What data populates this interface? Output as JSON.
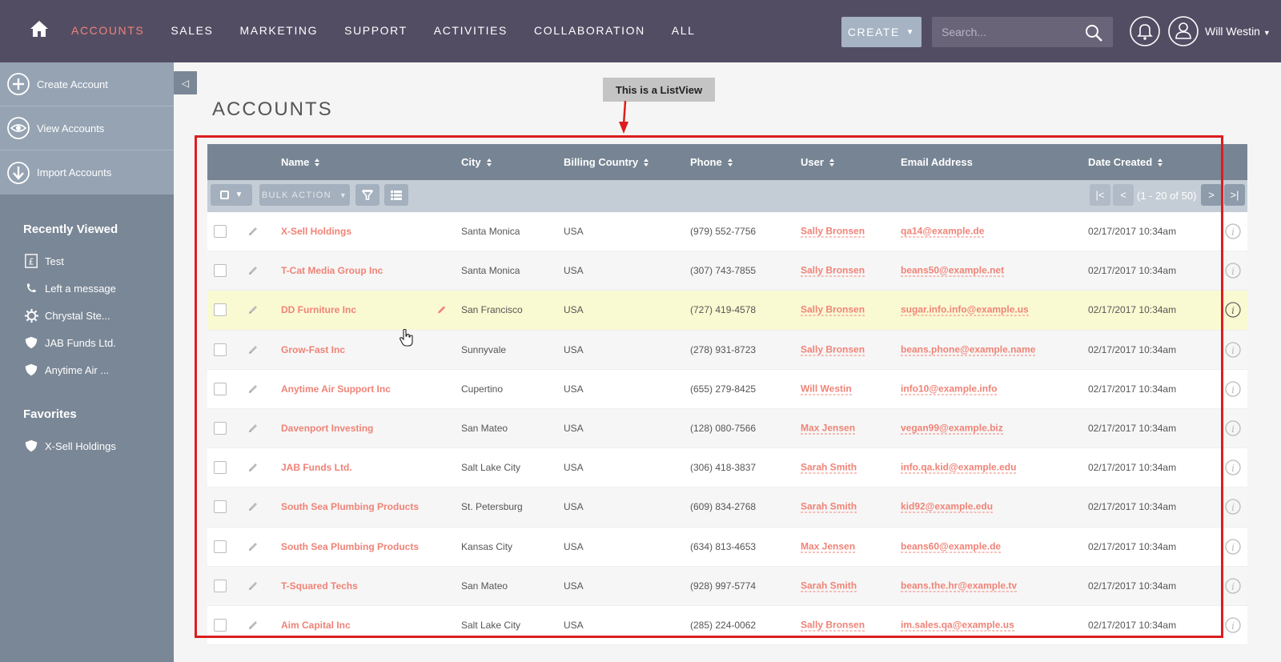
{
  "nav": {
    "items": [
      {
        "label": "ACCOUNTS",
        "active": true
      },
      {
        "label": "SALES",
        "active": false
      },
      {
        "label": "MARKETING",
        "active": false
      },
      {
        "label": "SUPPORT",
        "active": false
      },
      {
        "label": "ACTIVITIES",
        "active": false
      },
      {
        "label": "COLLABORATION",
        "active": false
      },
      {
        "label": "ALL",
        "active": false
      }
    ],
    "create_label": "CREATE",
    "search_placeholder": "Search...",
    "user_name": "Will Westin"
  },
  "sidebar": {
    "actions": [
      {
        "label": "Create Account",
        "icon": "plus-icon"
      },
      {
        "label": "View Accounts",
        "icon": "eye-icon"
      },
      {
        "label": "Import Accounts",
        "icon": "download-icon"
      }
    ],
    "recently_viewed_title": "Recently Viewed",
    "recently_viewed": [
      {
        "label": "Test",
        "icon": "pound-icon"
      },
      {
        "label": "Left a message",
        "icon": "phone-icon"
      },
      {
        "label": "Chrystal Ste...",
        "icon": "gear-icon"
      },
      {
        "label": "JAB Funds Ltd.",
        "icon": "shield-icon"
      },
      {
        "label": "Anytime Air ...",
        "icon": "shield-icon"
      }
    ],
    "favorites_title": "Favorites",
    "favorites": [
      {
        "label": "X-Sell Holdings",
        "icon": "shield-icon"
      }
    ]
  },
  "page_title": "ACCOUNTS",
  "annotation": "This is a ListView",
  "table": {
    "columns": {
      "name": "Name",
      "city": "City",
      "country": "Billing Country",
      "phone": "Phone",
      "user": "User",
      "email": "Email Address",
      "date": "Date Created"
    },
    "bulk_action_label": "BULK ACTION",
    "pagination": "(1 - 20 of 50)",
    "rows": [
      {
        "name": "X-Sell Holdings",
        "city": "Santa Monica",
        "country": "USA",
        "phone": "(979) 552-7756",
        "user": "Sally Bronsen",
        "email": "qa14@example.de",
        "date": "02/17/2017 10:34am"
      },
      {
        "name": "T-Cat Media Group Inc",
        "city": "Santa Monica",
        "country": "USA",
        "phone": "(307) 743-7855",
        "user": "Sally Bronsen",
        "email": "beans50@example.net",
        "date": "02/17/2017 10:34am"
      },
      {
        "name": "DD Furniture Inc",
        "city": "San Francisco",
        "country": "USA",
        "phone": "(727) 419-4578",
        "user": "Sally Bronsen",
        "email": "sugar.info.info@example.us",
        "date": "02/17/2017 10:34am"
      },
      {
        "name": "Grow-Fast Inc",
        "city": "Sunnyvale",
        "country": "USA",
        "phone": "(278) 931-8723",
        "user": "Sally Bronsen",
        "email": "beans.phone@example.name",
        "date": "02/17/2017 10:34am"
      },
      {
        "name": "Anytime Air Support Inc",
        "city": "Cupertino",
        "country": "USA",
        "phone": "(655) 279-8425",
        "user": "Will Westin",
        "email": "info10@example.info",
        "date": "02/17/2017 10:34am"
      },
      {
        "name": "Davenport Investing",
        "city": "San Mateo",
        "country": "USA",
        "phone": "(128) 080-7566",
        "user": "Max Jensen",
        "email": "vegan99@example.biz",
        "date": "02/17/2017 10:34am"
      },
      {
        "name": "JAB Funds Ltd.",
        "city": "Salt Lake City",
        "country": "USA",
        "phone": "(306) 418-3837",
        "user": "Sarah Smith",
        "email": "info.qa.kid@example.edu",
        "date": "02/17/2017 10:34am"
      },
      {
        "name": "South Sea Plumbing Products",
        "city": "St. Petersburg",
        "country": "USA",
        "phone": "(609) 834-2768",
        "user": "Sarah Smith",
        "email": "kid92@example.edu",
        "date": "02/17/2017 10:34am"
      },
      {
        "name": "South Sea Plumbing Products",
        "city": "Kansas City",
        "country": "USA",
        "phone": "(634) 813-4653",
        "user": "Max Jensen",
        "email": "beans60@example.de",
        "date": "02/17/2017 10:34am"
      },
      {
        "name": "T-Squared Techs",
        "city": "San Mateo",
        "country": "USA",
        "phone": "(928) 997-5774",
        "user": "Sarah Smith",
        "email": "beans.the.hr@example.tv",
        "date": "02/17/2017 10:34am"
      },
      {
        "name": "Aim Capital Inc",
        "city": "Salt Lake City",
        "country": "USA",
        "phone": "(285) 224-0062",
        "user": "Sally Bronsen",
        "email": "im.sales.qa@example.us",
        "date": "02/17/2017 10:34am"
      }
    ]
  },
  "colors": {
    "nav_bg": "#534d64",
    "accent": "#f08377",
    "sidebar_bg": "#7a8796",
    "header_bg": "#778493",
    "highlight": "#fafad2",
    "annotation_red": "#dc1e1e"
  }
}
